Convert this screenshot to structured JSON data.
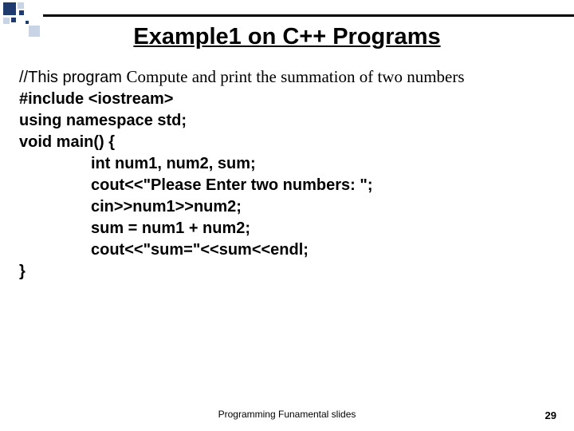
{
  "title": "Example1 on C++ Programs",
  "comment": {
    "prefix": "//This program ",
    "rest": "Compute and print the summation of two numbers"
  },
  "code": {
    "l1": "#include <iostream>",
    "l2": "using namespace std;",
    "l3": "void main() {",
    "l4": "int num1, num2, sum;",
    "l5": "cout<<\"Please Enter two numbers: \";",
    "l6": "cin>>num1>>num2;",
    "l7": "sum = num1 + num2;",
    "l8": "cout<<\"sum=\"<<sum<<endl;",
    "l9": "}"
  },
  "footer": "Programming Funamental slides",
  "page_number": "29"
}
